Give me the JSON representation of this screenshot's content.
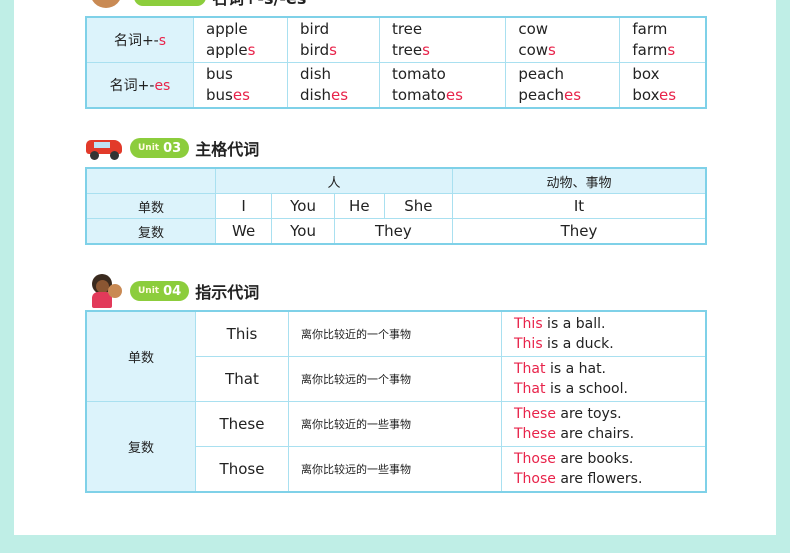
{
  "section1": {
    "title": "名词+-s/-es",
    "rows": [
      {
        "label_base": "名词+-",
        "label_suffix": "s",
        "words": [
          {
            "singular": "apple",
            "stem": "apple",
            "suffix": "s"
          },
          {
            "singular": "bird",
            "stem": "bird",
            "suffix": "s"
          },
          {
            "singular": "tree",
            "stem": "tree",
            "suffix": "s"
          },
          {
            "singular": "cow",
            "stem": "cow",
            "suffix": "s"
          },
          {
            "singular": "farm",
            "stem": "farm",
            "suffix": "s"
          }
        ]
      },
      {
        "label_base": "名词+-",
        "label_suffix": "es",
        "words": [
          {
            "singular": "bus",
            "stem": "bus",
            "suffix": "es"
          },
          {
            "singular": "dish",
            "stem": "dish",
            "suffix": "es"
          },
          {
            "singular": "tomato",
            "stem": "tomato",
            "suffix": "es"
          },
          {
            "singular": "peach",
            "stem": "peach",
            "suffix": "es"
          },
          {
            "singular": "box",
            "stem": "box",
            "suffix": "es"
          }
        ]
      }
    ]
  },
  "section2": {
    "unit_word": "Unit",
    "unit_num": "03",
    "title": "主格代词",
    "header_people": "人",
    "header_things": "动物、事物",
    "singular_label": "单数",
    "plural_label": "复数",
    "singular": [
      "I",
      "You",
      "He",
      "She",
      "It"
    ],
    "plural": [
      "We",
      "You",
      "They",
      "They"
    ]
  },
  "section3": {
    "unit_word": "Unit",
    "unit_num": "04",
    "title": "指示代词",
    "singular_label": "单数",
    "plural_label": "复数",
    "rows": [
      {
        "pronoun": "This",
        "desc": "离你比较近的一个事物",
        "ex1_word": "This",
        "ex1_rest": " is a ball.",
        "ex2_word": "This",
        "ex2_rest": " is a duck."
      },
      {
        "pronoun": "That",
        "desc": "离你比较远的一个事物",
        "ex1_word": "That",
        "ex1_rest": " is a hat.",
        "ex2_word": "That",
        "ex2_rest": " is a school."
      },
      {
        "pronoun": "These",
        "desc": "离你比较近的一些事物",
        "ex1_word": "These",
        "ex1_rest": " are toys.",
        "ex2_word": "These",
        "ex2_rest": " are chairs."
      },
      {
        "pronoun": "Those",
        "desc": "离你比较远的一些事物",
        "ex1_word": "Those",
        "ex1_rest": " are books.",
        "ex2_word": "Those",
        "ex2_rest": " are flowers."
      }
    ]
  },
  "colors": {
    "accent_red": "#e8234a",
    "unit_green": "#8ccd3c",
    "table_border": "#7fd1e8",
    "label_bg": "#dcf3fb",
    "page_bg": "#bfeee6"
  }
}
